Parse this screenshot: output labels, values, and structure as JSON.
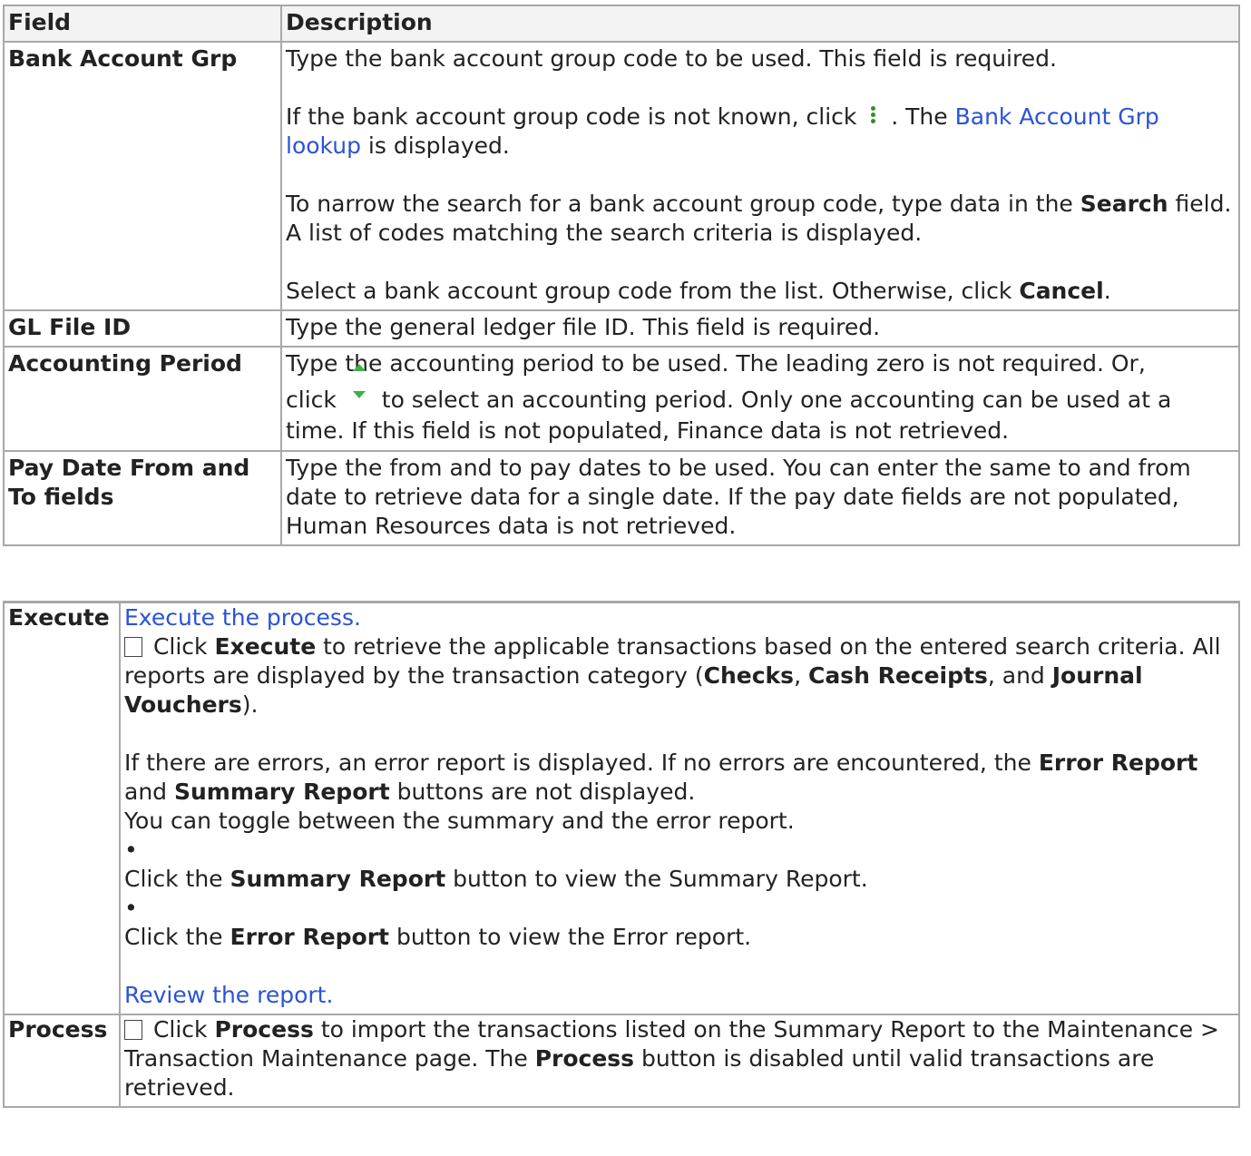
{
  "header": {
    "field": "Field",
    "description": "Description"
  },
  "rows": [
    {
      "field": "Bank Account Grp",
      "p1": "Type the bank account group code to be used. This field is required.",
      "p2a": "If the bank account group code is not known, click",
      "p2b": ". The",
      "p2link": "Bank Account Grp lookup",
      "p2c": "is displayed.",
      "p3a": "To narrow the search for a bank account group code, type data in the",
      "p3b": "Search",
      "p3c": "field. A list of codes matching the search criteria is displayed.",
      "p4a": "Select a bank account group code from the list. Otherwise, click",
      "p4b": "Cancel",
      "p4c": "."
    },
    {
      "field": "GL File ID",
      "desc": "Type the general ledger file ID. This field is required."
    },
    {
      "field": "Accounting Period",
      "d1": "Type the accounting period to be used. The leading zero is not required. Or,",
      "d2": "click",
      "d3": "to select an accounting period. Only one accounting can be used at a time. If this field is not populated, Finance data is not retrieved."
    },
    {
      "field": "Pay Date From and To fields",
      "desc": "Type the from and to pay dates to be used. You can enter the same to and from date to retrieve data for a single date. If the pay date fields are not populated, Human Resources data is not retrieved."
    }
  ],
  "actions": [
    {
      "field": "Execute",
      "link1": "Execute the process.",
      "a1": "Click",
      "a1b": "Execute",
      "a1c": "to retrieve the applicable transactions based on the entered search criteria. All reports are displayed by the transaction category (",
      "a1d": "Checks",
      "a1e": ",",
      "a1f": "Cash Receipts",
      "a1g": ", and",
      "a1h": "Journal Vouchers",
      "a1i": ").",
      "e1": "If there are errors, an error report is displayed. If no errors are encountered, the",
      "e1b": "Error Report",
      "e1c": "and",
      "e1d": "Summary Report",
      "e1e": "buttons are not displayed.",
      "toggle": "You can toggle between the summary and the error report.",
      "bullet": "•",
      "s1": "Click the",
      "s1b": "Summary Report",
      "s1c": "button to view the Summary Report.",
      "r1": "Click the",
      "r1b": "Error Report",
      "r1c": "button to view the Error report.",
      "link2": "Review the report."
    },
    {
      "field": "Process",
      "p1": "Click",
      "p1b": "Process",
      "p1c": "to import the transactions listed on the Summary Report to the Maintenance > Transaction Maintenance page. The",
      "p1d": "Process",
      "p1e": "button is disabled until valid transactions are retrieved."
    }
  ],
  "icons": {
    "lookup": "vertical-dots-icon",
    "spinner": "up-down-spinner-icon",
    "checkbox": "checkbox-icon"
  }
}
